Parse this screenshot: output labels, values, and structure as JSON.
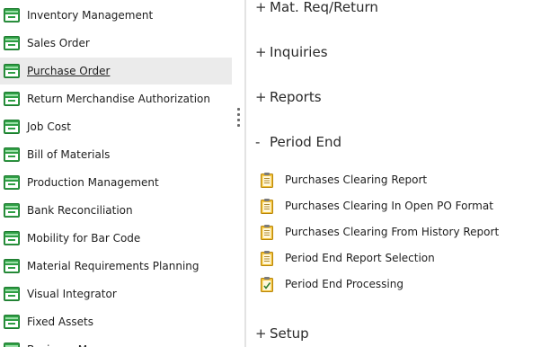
{
  "sidebar": {
    "items": [
      {
        "label": "Inventory Management",
        "selected": false
      },
      {
        "label": "Sales Order",
        "selected": false
      },
      {
        "label": "Purchase Order",
        "selected": true
      },
      {
        "label": "Return Merchandise Authorization",
        "selected": false
      },
      {
        "label": "Job Cost",
        "selected": false
      },
      {
        "label": "Bill of Materials",
        "selected": false
      },
      {
        "label": "Production Management",
        "selected": false
      },
      {
        "label": "Bank Reconciliation",
        "selected": false
      },
      {
        "label": "Mobility for Bar Code",
        "selected": false
      },
      {
        "label": "Material Requirements Planning",
        "selected": false
      },
      {
        "label": "Visual Integrator",
        "selected": false
      },
      {
        "label": "Fixed Assets",
        "selected": false
      },
      {
        "label": "Business Manager",
        "selected": false
      }
    ]
  },
  "main": {
    "sections": [
      {
        "sign": "+",
        "title": "Mat. Req/Return",
        "expanded": false
      },
      {
        "sign": "+",
        "title": "Inquiries",
        "expanded": false
      },
      {
        "sign": "+",
        "title": "Reports",
        "expanded": false
      },
      {
        "sign": "-",
        "title": "Period End",
        "expanded": true
      },
      {
        "sign": "+",
        "title": "Setup",
        "expanded": false
      }
    ],
    "period_end_tasks": [
      {
        "label": "Purchases Clearing Report",
        "icon": "report-clipboard-icon"
      },
      {
        "label": "Purchases Clearing In Open PO Format",
        "icon": "report-clipboard-icon"
      },
      {
        "label": "Purchases Clearing From History Report",
        "icon": "report-clipboard-icon"
      },
      {
        "label": "Period End Report Selection",
        "icon": "report-clipboard-icon"
      },
      {
        "label": "Period End Processing",
        "icon": "checked-clipboard-icon"
      }
    ]
  },
  "colors": {
    "module_icon_green": "#2e9e44",
    "selected_row": "#ebebeb",
    "clipboard_yellow": "#f2c23a"
  }
}
